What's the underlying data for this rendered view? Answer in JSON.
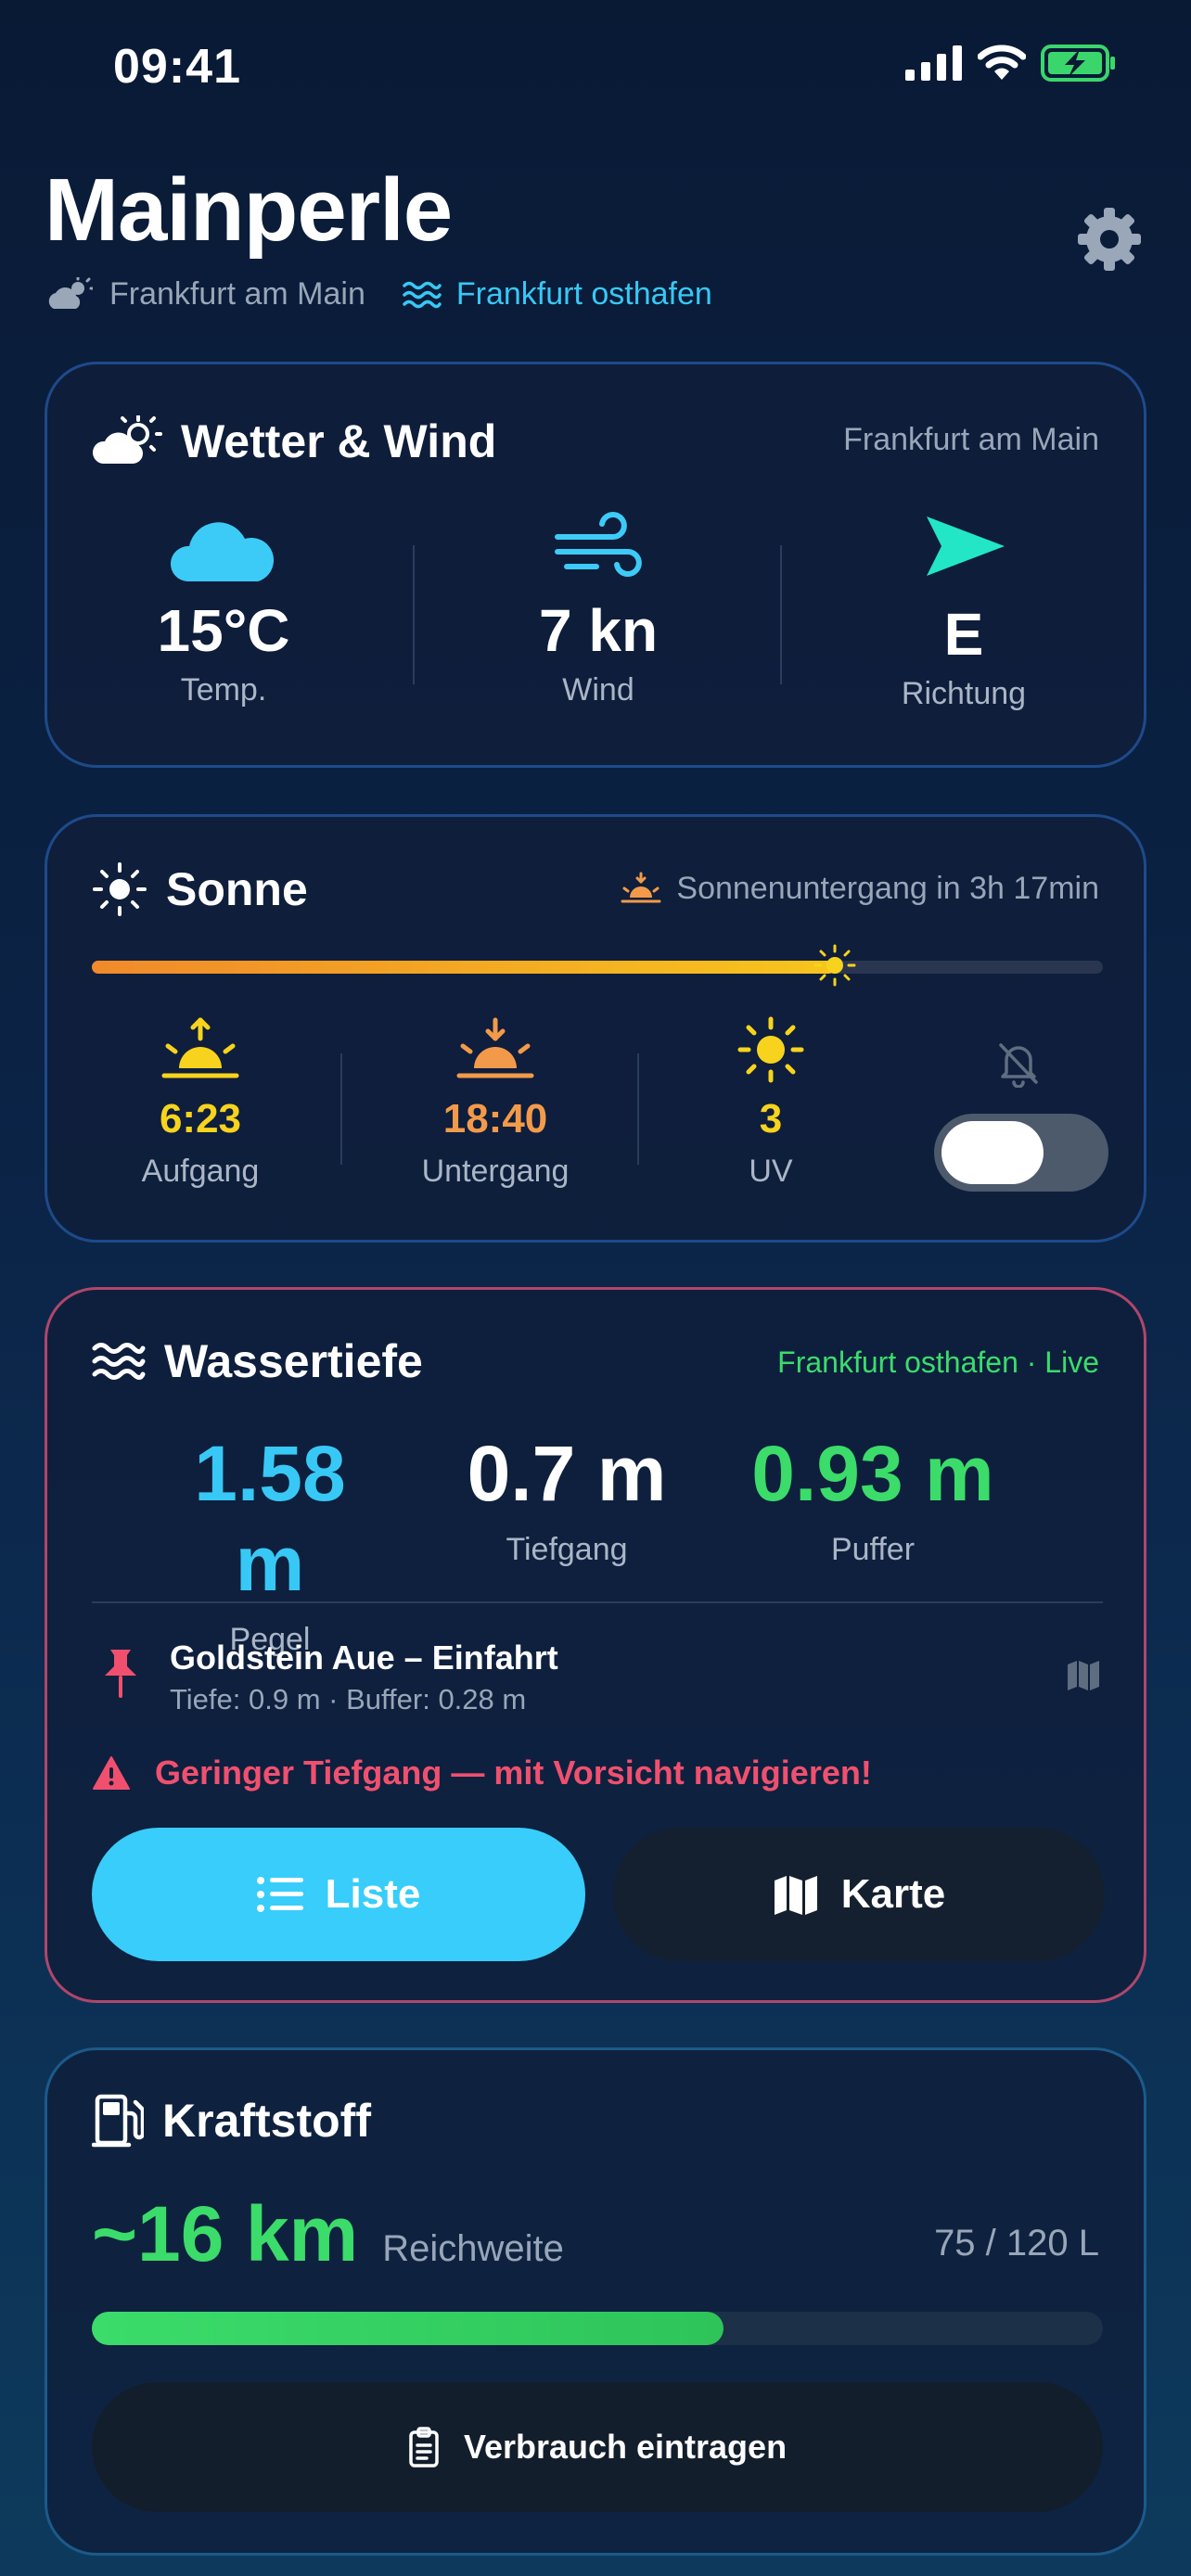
{
  "status_bar": {
    "time": "09:41"
  },
  "header": {
    "title": "Mainperle",
    "city": "Frankfurt am Main",
    "harbor": "Frankfurt osthafen"
  },
  "weather": {
    "title": "Wetter & Wind",
    "location": "Frankfurt am Main",
    "temp_value": "15°C",
    "temp_label": "Temp.",
    "wind_value": "7 kn",
    "wind_label": "Wind",
    "dir_value": "E",
    "dir_label": "Richtung"
  },
  "sun": {
    "title": "Sonne",
    "sunset_countdown": "Sonnenuntergang in 3h 17min",
    "day_progress": 0.735,
    "sunrise_value": "6:23",
    "sunrise_label": "Aufgang",
    "sunset_value": "18:40",
    "sunset_label": "Untergang",
    "uv_value": "3",
    "uv_label": "UV",
    "alarm_on": false
  },
  "water": {
    "title": "Wassertiefe",
    "source": "Frankfurt osthafen · Live",
    "gauge_value": "1.58 m",
    "gauge_label": "Pegel",
    "draft_value": "0.7 m",
    "draft_label": "Tiefgang",
    "buffer_value": "0.93 m",
    "buffer_label": "Puffer",
    "spot_name": "Goldstein Aue – Einfahrt",
    "spot_detail": "Tiefe: 0.9 m · Buffer: 0.28 m",
    "warning": "Geringer Tiefgang — mit Vorsicht navigieren!",
    "list_label": "Liste",
    "map_label": "Karte"
  },
  "fuel": {
    "title": "Kraftstoff",
    "range_value": "~16 km",
    "range_label": "Reichweite",
    "tank_text": "75 / 120 L",
    "level_fraction": 0.625,
    "log_label": "Verbrauch eintragen"
  },
  "colors": {
    "accent": "#38c8f5",
    "green": "#3bdc6a",
    "warning": "#f0506e",
    "sunrise": "#f7d31d",
    "sunset": "#f39a4a"
  }
}
